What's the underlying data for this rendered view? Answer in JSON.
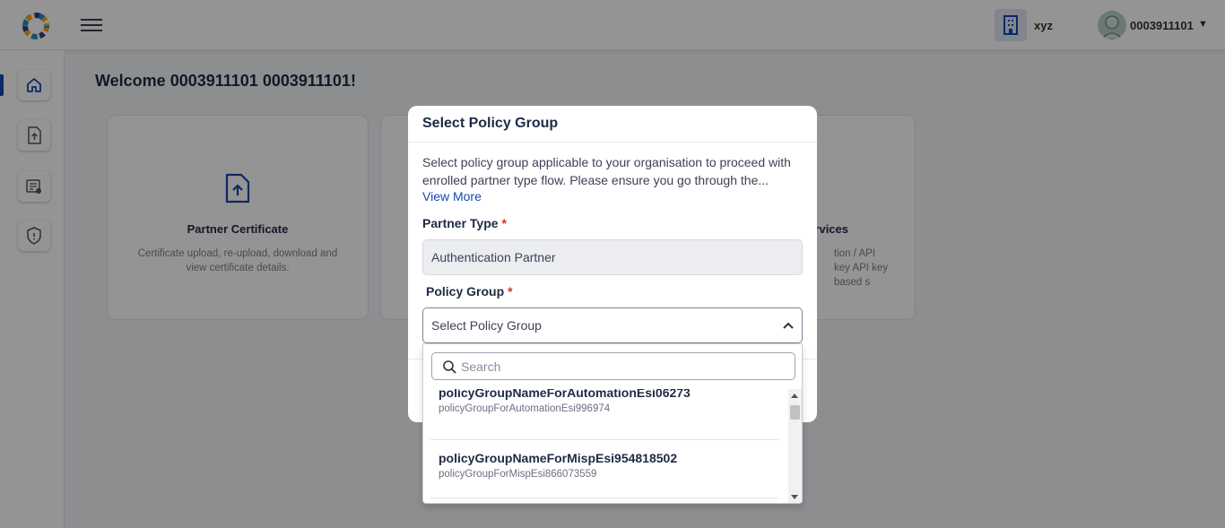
{
  "header": {
    "org_name": "xyz",
    "user_name": "0003911101",
    "user_caret": "▼"
  },
  "main": {
    "welcome": "Welcome 0003911101 0003911101!",
    "cards": [
      {
        "title": "Partner Certificate",
        "description": "Certificate upload, re-upload, download and view certificate details."
      },
      {
        "title": "",
        "description": ""
      },
      {
        "title": "Services",
        "description": "tion / API key API key based s"
      }
    ]
  },
  "modal": {
    "title": "Select Policy Group",
    "description": "Select policy group applicable to your organisation to proceed with enrolled partner type flow. Please ensure you go through the...",
    "view_more": "View More",
    "partner_type_label": "Partner Type",
    "partner_type_value": "Authentication Partner",
    "policy_group_label": "Policy Group",
    "policy_group_placeholder": "Select Policy Group",
    "required_mark": "*"
  },
  "dropdown": {
    "search_placeholder": "Search",
    "items": [
      {
        "name": "policyGroupNameForAutomationEsi06273",
        "description": "policyGroupForAutomationEsi996974"
      },
      {
        "name": "policyGroupNameForMispEsi954818502",
        "description": "policyGroupForMispEsi866073559"
      }
    ]
  },
  "colors": {
    "accent": "#1447b2",
    "required": "#d32f2f",
    "overlay": "rgba(0,0,0,0.42)"
  },
  "icons": [
    "app-logo-icon",
    "hamburger-menu-icon",
    "building-icon",
    "user-avatar-icon",
    "home-icon",
    "upload-file-icon",
    "policy-doc-icon",
    "shield-icon",
    "upload-certificate-icon",
    "chevron-up-icon",
    "search-icon"
  ]
}
